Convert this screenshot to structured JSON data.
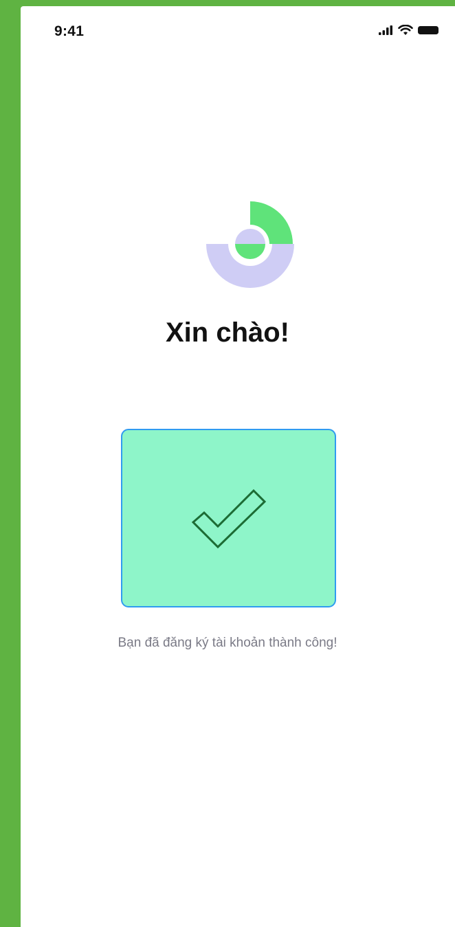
{
  "status_bar": {
    "time": "9:41",
    "signal_icon": "cellular-signal-icon",
    "wifi_icon": "wifi-icon",
    "battery_icon": "battery-icon"
  },
  "app_logo": {
    "icon": "app-logo-icon",
    "colors": {
      "green": "#5fe37a",
      "lavender": "#cfcdf5"
    }
  },
  "greeting": {
    "title": "Xin chào!"
  },
  "success": {
    "icon": "checkmark-icon",
    "card_color": "#8ef5c9",
    "border_color": "#2f9bf0",
    "check_color": "#1c6b34",
    "message": "Bạn đã đăng ký tài khoản thành công!"
  },
  "colors": {
    "frame_green": "#5fb342",
    "background": "#ffffff"
  }
}
